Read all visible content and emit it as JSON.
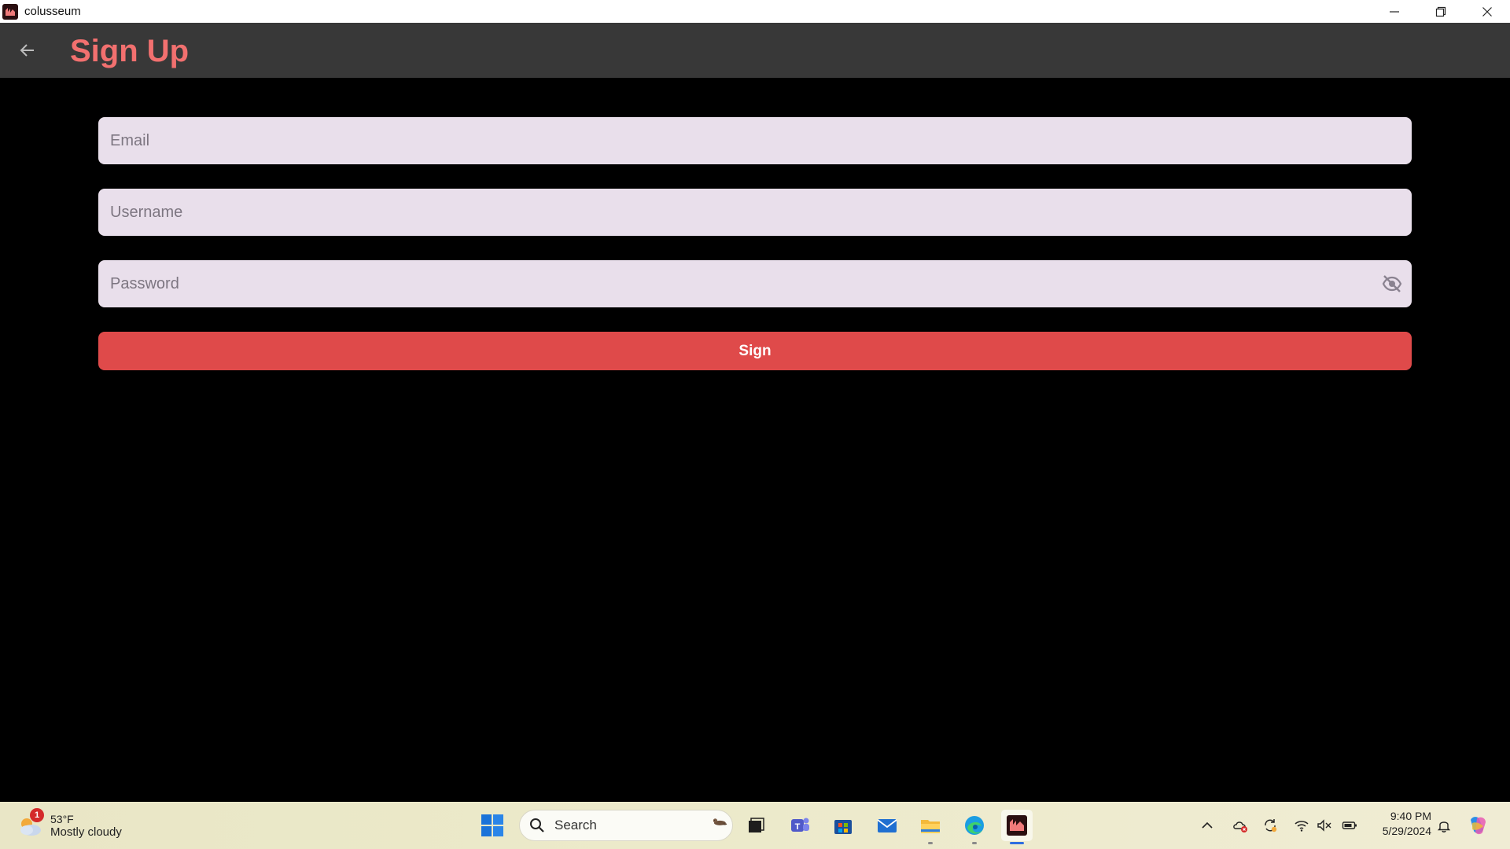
{
  "window": {
    "title": "colusseum",
    "controls": [
      "minimize-icon",
      "restore-icon",
      "close-icon"
    ]
  },
  "appbar": {
    "back_icon": "arrow-left-icon",
    "title": "Sign Up"
  },
  "form": {
    "email": {
      "placeholder": "Email",
      "value": ""
    },
    "username": {
      "placeholder": "Username",
      "value": ""
    },
    "password": {
      "placeholder": "Password",
      "value": "",
      "toggle_icon": "eye-off-icon"
    },
    "submit_label": "Sign"
  },
  "colors": {
    "accent": "#f2706f",
    "button": "#df4a4a",
    "field_bg": "#e9dfeb",
    "appbar_bg": "#383838",
    "page_bg": "#000000"
  },
  "taskbar": {
    "weather": {
      "temp": "53°F",
      "desc": "Mostly cloudy",
      "badge": "1"
    },
    "search": {
      "label": "Search"
    },
    "apps": [
      "start-icon",
      "task-view-icon",
      "teams-icon",
      "store-icon",
      "mail-icon",
      "file-explorer-icon",
      "edge-icon",
      "colusseum-icon"
    ],
    "tray_icons": [
      "chevron-up-icon",
      "cloud-error-icon",
      "sync-icon",
      "wifi-icon",
      "volume-muted-icon",
      "battery-icon",
      "bell-icon",
      "copilot-icon"
    ],
    "clock": {
      "time": "9:40 PM",
      "date": "5/29/2024"
    }
  }
}
